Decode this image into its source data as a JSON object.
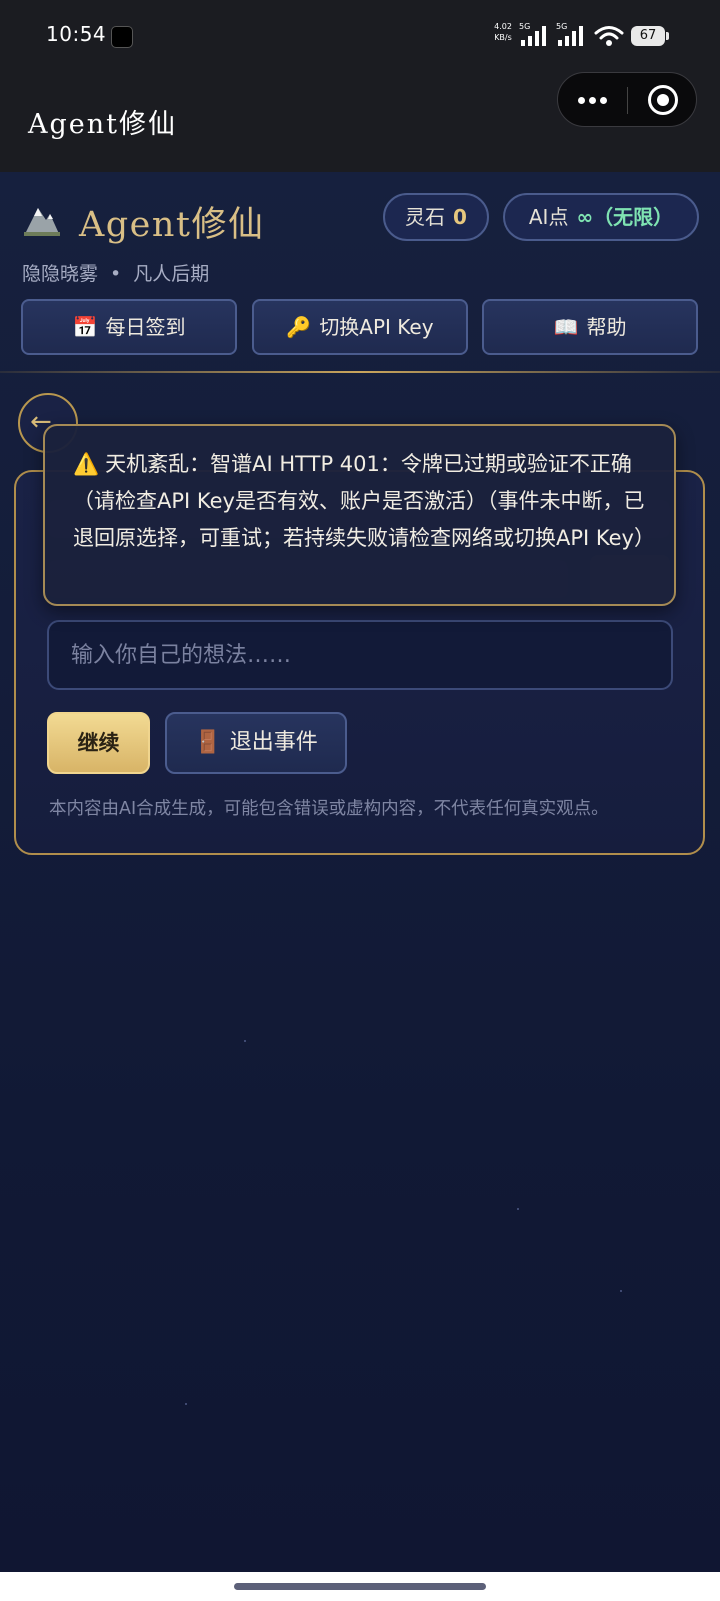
{
  "status_bar": {
    "time": "10:54",
    "net_speed_value": "4.02",
    "net_speed_unit": "KB/s",
    "signal1_tag": "5G",
    "signal2_tag": "5G",
    "battery": "67"
  },
  "title_bar": {
    "title": "Agent修仙"
  },
  "header": {
    "title": "Agent修仙",
    "spirit_stone_label": "灵石",
    "spirit_stone_value": "0",
    "ai_points_label": "AI点",
    "ai_points_value": "∞（无限）",
    "weather": "隐隐晓雾",
    "separator": "•",
    "realm": "凡人后期"
  },
  "actions": {
    "checkin_label": "每日签到",
    "switch_key_label": "切换API Key",
    "help_label": "帮助"
  },
  "event": {
    "input_placeholder": "输入你自己的想法……",
    "continue_label": "继续",
    "exit_label": "退出事件",
    "disclaimer": "本内容由AI合成生成，可能包含错误或虚构内容，不代表任何真实观点。"
  },
  "error_toast": {
    "icon": "⚠️",
    "message": "天机紊乱：智谱AI HTTP 401：令牌已过期或验证不正确（请检查API Key是否有效、账户是否激活）（事件未中断，已退回原选择，可重试；若持续失败请检查网络或切换API Key）"
  },
  "colors": {
    "background": "#141d3a",
    "gold_accent": "#d9bf86",
    "green_accent": "#7fe3b2"
  }
}
